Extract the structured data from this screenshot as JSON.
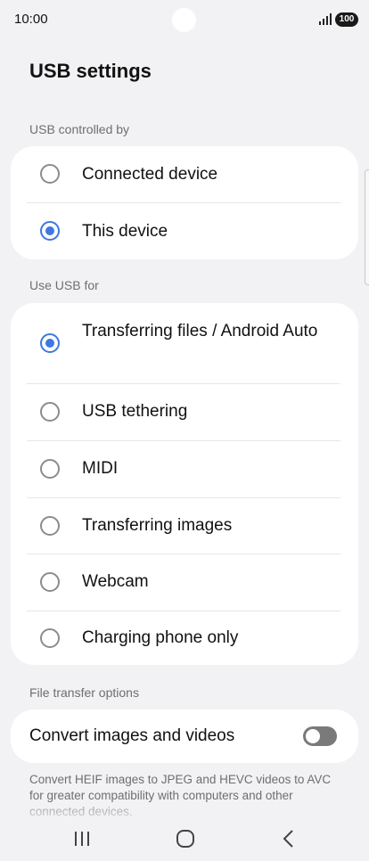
{
  "status_bar": {
    "time": "10:00",
    "battery": "100",
    "icons": [
      "signal-icon",
      "battery-icon"
    ]
  },
  "page": {
    "title": "USB settings"
  },
  "usb_controlled_by": {
    "header": "USB controlled by",
    "options": [
      {
        "label": "Connected device",
        "selected": false
      },
      {
        "label": "This device",
        "selected": true
      }
    ]
  },
  "use_usb_for": {
    "header": "Use USB for",
    "options": [
      {
        "label": "Transferring files / Android Auto",
        "selected": true
      },
      {
        "label": "USB tethering",
        "selected": false
      },
      {
        "label": "MIDI",
        "selected": false
      },
      {
        "label": "Transferring images",
        "selected": false
      },
      {
        "label": "Webcam",
        "selected": false
      },
      {
        "label": "Charging phone only",
        "selected": false
      }
    ]
  },
  "file_transfer_options": {
    "header": "File transfer options",
    "convert_label": "Convert images and videos",
    "convert_enabled": false,
    "description": "Convert HEIF images to JPEG and HEVC videos to AVC for greater compatibility with computers and other connected devices."
  },
  "nav_bar": {
    "icons": [
      "recents-icon",
      "home-icon",
      "back-icon"
    ]
  },
  "colors": {
    "accent": "#3e78e3",
    "background": "#f2f2f4",
    "card": "#ffffff",
    "toggle_off": "#7a7a7a"
  }
}
